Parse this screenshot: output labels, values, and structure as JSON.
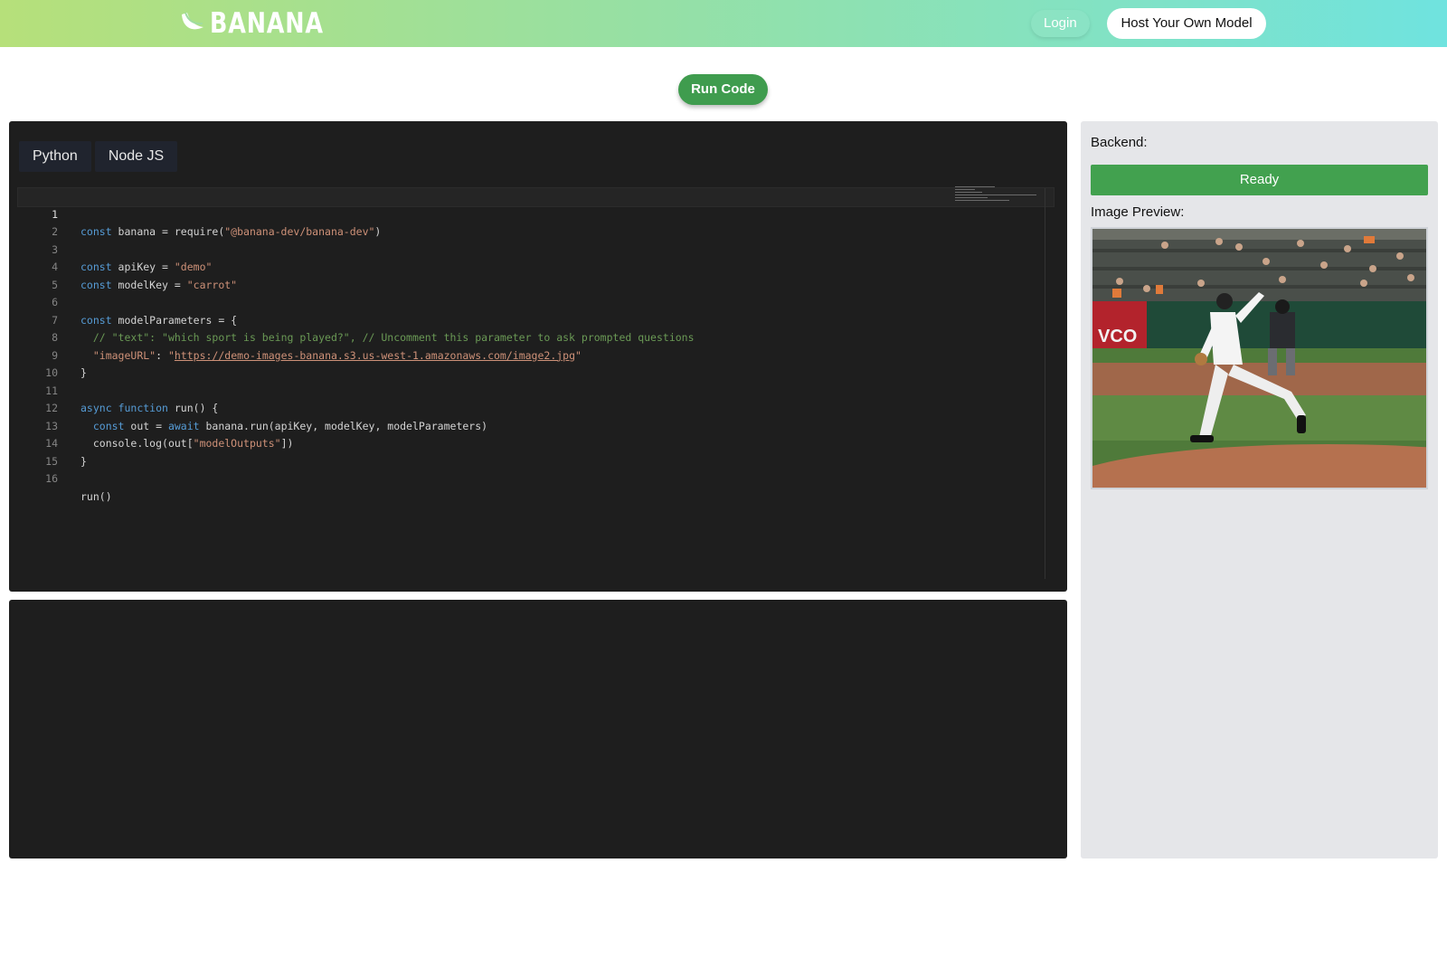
{
  "header": {
    "logo_text": "BANANA",
    "login_label": "Login",
    "host_label": "Host Your Own Model"
  },
  "actions": {
    "run_label": "Run Code"
  },
  "editor": {
    "tabs": [
      {
        "label": "Python"
      },
      {
        "label": "Node JS"
      }
    ],
    "lines": [
      {
        "n": "1"
      },
      {
        "n": "2"
      },
      {
        "n": "3"
      },
      {
        "n": "4"
      },
      {
        "n": "5"
      },
      {
        "n": "6"
      },
      {
        "n": "7"
      },
      {
        "n": "8"
      },
      {
        "n": "9"
      },
      {
        "n": "10"
      },
      {
        "n": "11"
      },
      {
        "n": "12"
      },
      {
        "n": "13"
      },
      {
        "n": "14"
      },
      {
        "n": "15"
      },
      {
        "n": "16"
      }
    ],
    "code": {
      "l1": {
        "kw": "const",
        "rest": " banana = require(",
        "str": "\"@banana-dev/banana-dev\"",
        "end": ")"
      },
      "l3": {
        "kw": "const",
        "rest": " apiKey = ",
        "str": "\"demo\""
      },
      "l4": {
        "kw": "const",
        "rest": " modelKey = ",
        "str": "\"carrot\""
      },
      "l6": {
        "kw": "const",
        "rest": " modelParameters = {"
      },
      "l7": {
        "comment": "// \"text\": \"which sport is being played?\", // Uncomment this parameter to ask prompted questions"
      },
      "l8": {
        "key": "\"imageURL\"",
        "colon": ": ",
        "q1": "\"",
        "url": "https://demo-images-banana.s3.us-west-1.amazonaws.com/image2.jpg",
        "q2": "\""
      },
      "l9": {
        "text": "}"
      },
      "l11": {
        "kw1": "async",
        "kw2": "function",
        "rest": " run() {"
      },
      "l12": {
        "kw1": "const",
        "rest1": " out = ",
        "kw2": "await",
        "rest2": " banana.run(apiKey, modelKey, modelParameters)"
      },
      "l13": {
        "pre": "console.log(out[",
        "str": "\"modelOutputs\"",
        "end": "])"
      },
      "l14": {
        "text": "}"
      },
      "l16": {
        "text": "run()"
      }
    }
  },
  "panel": {
    "backend_label": "Backend:",
    "status": "Ready",
    "preview_label": "Image Preview:"
  },
  "colors": {
    "accent_green": "#42a14f",
    "editor_bg": "#1e1e1e",
    "panel_bg": "#e5e6e9"
  }
}
